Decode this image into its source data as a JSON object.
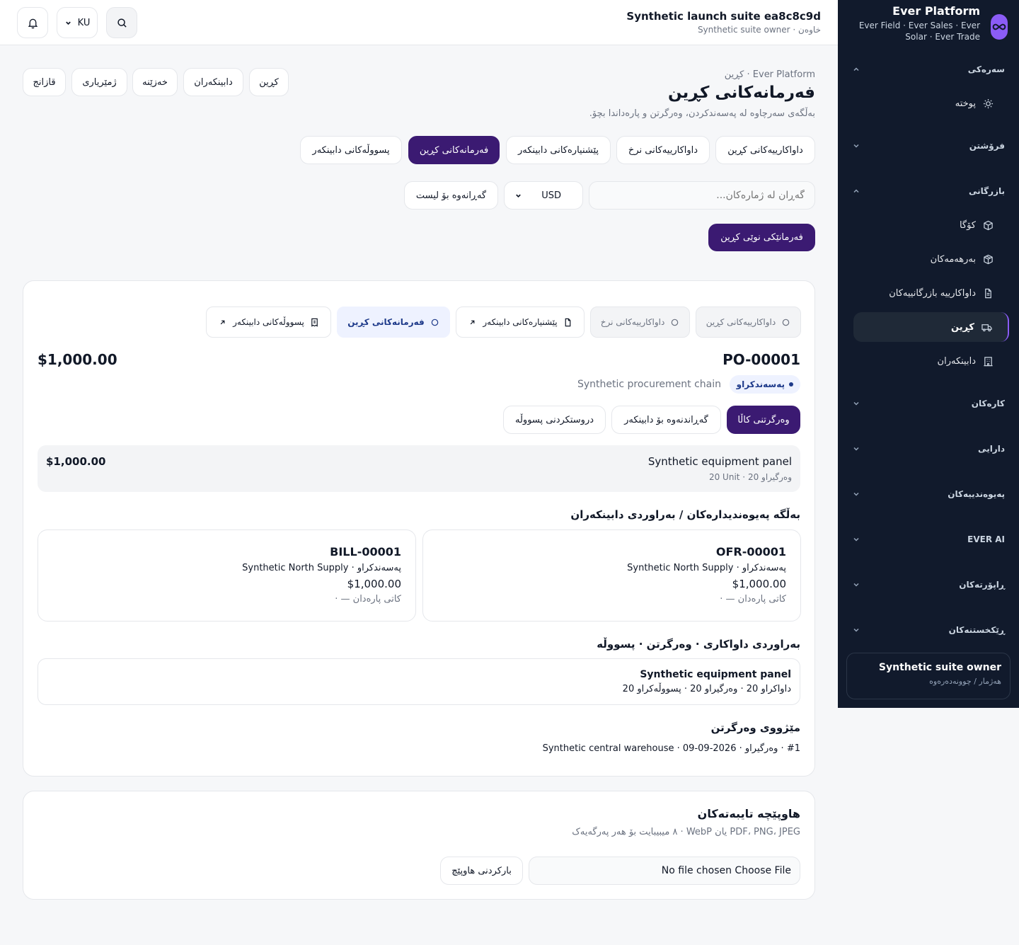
{
  "brand": {
    "title": "Ever Platform",
    "subtitle": "Ever Field · Ever Sales · Ever Solar · Ever Trade",
    "logo_icon": "infinity-icon",
    "accent": "#8b5cf6"
  },
  "sidebar": {
    "groups": [
      {
        "label": "سەرەکی",
        "state": "expanded"
      },
      {
        "label": "فرۆشتن",
        "state": "collapsed"
      },
      {
        "label": "بازرگانی",
        "state": "expanded"
      },
      {
        "label": "کارەکان",
        "state": "collapsed"
      },
      {
        "label": "دارایی",
        "state": "collapsed"
      },
      {
        "label": "پەیوەندییەکان",
        "state": "collapsed"
      },
      {
        "label": "EVER AI",
        "state": "collapsed"
      },
      {
        "label": "ڕاپۆرتەکان",
        "state": "collapsed"
      },
      {
        "label": "ڕێکخستنەکان",
        "state": "collapsed"
      }
    ],
    "items": [
      {
        "label": "پوختە",
        "icon": "sun-icon"
      },
      {
        "label": "کۆگا",
        "icon": "box-icon"
      },
      {
        "label": "بەرهەمەکان",
        "icon": "package-icon"
      },
      {
        "label": "داواکارییە بازرگانییەکان",
        "icon": "document-icon"
      },
      {
        "label": "کڕین",
        "icon": "truck-icon",
        "active": true
      },
      {
        "label": "دابینکەران",
        "icon": "building-icon"
      }
    ],
    "owner": {
      "name": "Synthetic suite owner",
      "sub": "هەژمار / چوونەدەرەوە"
    }
  },
  "header": {
    "title": "Synthetic launch suite ea8c8c9d",
    "subtitle": "Synthetic suite owner · خاوەن",
    "lang": "KU"
  },
  "page": {
    "breadcrumb": "Ever Platform · کڕین",
    "title": "فەرمانەکانی کڕین",
    "description": "بەڵگەی سەرچاوە لە پەسەندکردن، وەرگرتن و پارەداندا بچۆ.",
    "module_tabs": [
      "کڕین",
      "دابینکەران",
      "خەزێنە",
      "ژمێریاری",
      "قازانج"
    ],
    "doc_tabs": [
      "داواکارییەکانی کڕین",
      "داواکارییەکانی نرخ",
      "پێشنیارەکانی دابینکەر",
      "فەرمانەکانی کڕین",
      "پسووڵەکانی دابینکەر"
    ],
    "active_doc_tab": 3,
    "search_placeholder": "گەڕان لە ژمارەکان...",
    "currency": "USD",
    "back_label": "گەڕانەوە بۆ لیست",
    "new_label": "فەرمانێکی نوێی کڕین"
  },
  "order": {
    "chain": [
      {
        "label": "داواکارییەکانی کڕین",
        "icon": "circle-icon",
        "state": "dim"
      },
      {
        "label": "داواکارییەکانی نرخ",
        "icon": "circle-icon",
        "state": "dim"
      },
      {
        "label": "پێشنیارەکانی دابینکەر",
        "icon": "file-icon",
        "state": "link"
      },
      {
        "label": "فەرمانەکانی کڕین",
        "icon": "circle-icon",
        "state": "active"
      },
      {
        "label": "پسووڵەکانی دابینکەر",
        "icon": "receipt-icon",
        "state": "link"
      }
    ],
    "number": "PO-00001",
    "total": "$1,000.00",
    "status": "پەسەندکراو",
    "chain_name": "Synthetic procurement chain",
    "actions": [
      "وەرگرتنی کاڵا",
      "گەڕاندنەوە بۆ دابینکەر",
      "دروستکردنی پسووڵە"
    ],
    "line": {
      "name": "Synthetic equipment panel",
      "meta": "20 Unit · وەرگیراو 20",
      "amount": "$1,000.00"
    },
    "related_title": "بەڵگە پەیوەندیدارەکان / بەراوردی دابینکەران",
    "related": [
      {
        "number": "OFR-00001",
        "supplier": "Synthetic North Supply · پەسەندکراو",
        "amount": "$1,000.00",
        "due": "کاتی پارەدان — ·"
      },
      {
        "number": "BILL-00001",
        "supplier": "Synthetic North Supply · پەسەندکراو",
        "amount": "$1,000.00",
        "due": "کاتی پارەدان — ·"
      }
    ],
    "match_title": "بەراوردی داواکاری · وەرگرتن · پسووڵە",
    "match": {
      "name": "Synthetic equipment panel",
      "meta": "داواکراو 20 · وەرگیراو 20 · پسووڵەکراو 20"
    },
    "history_title": "مێژووی وەرگرتن",
    "history_line": "#1 · وەرگیراو · 2026-09-09 · Synthetic central warehouse"
  },
  "attachments": {
    "title": "هاوپێچە تایبەتەکان",
    "hint": "PDF، PNG، JPEG یان WebP · ٨ میبیبایت بۆ هەر پەرگەیەک",
    "file_text": "No file chosen Choose File",
    "upload_label": "بارکردنی هاوپێچ"
  }
}
